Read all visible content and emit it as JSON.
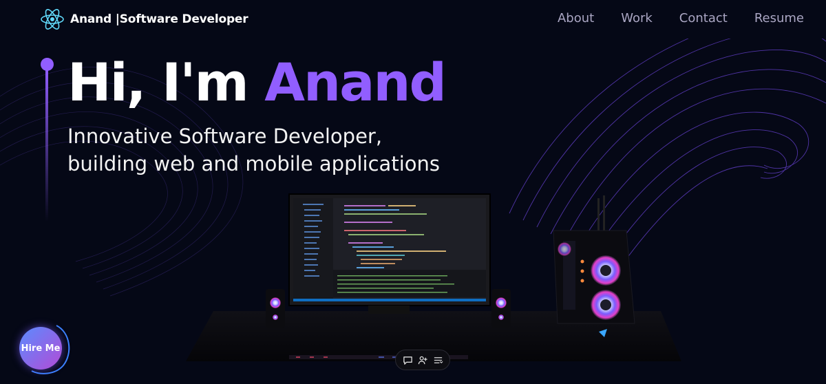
{
  "brand": {
    "name": "Anand",
    "separator": " |",
    "tagline": "Software Developer",
    "icon": "react-atom-icon"
  },
  "nav": {
    "items": [
      {
        "label": "About"
      },
      {
        "label": "Work"
      },
      {
        "label": "Contact"
      },
      {
        "label": "Resume"
      }
    ]
  },
  "hero": {
    "greeting": "Hi, I'm ",
    "name": "Anand",
    "subtitle_line1": "Innovative Software Developer,",
    "subtitle_line2": "building web and mobile applications"
  },
  "hire": {
    "label": "Hire Me"
  },
  "dock": {
    "icons": [
      "chat-icon",
      "add-user-icon",
      "list-icon"
    ]
  },
  "colors": {
    "accent": "#915eff",
    "background": "#050816",
    "nav_text": "#aaa6c3"
  }
}
